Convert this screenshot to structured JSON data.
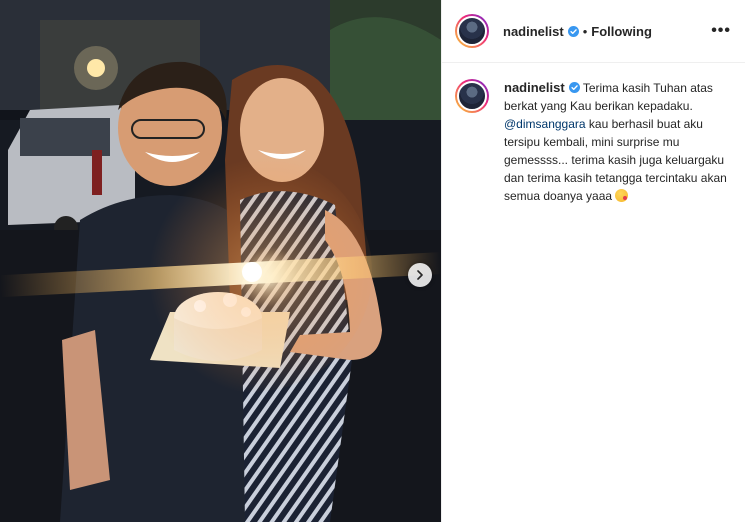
{
  "post": {
    "username": "nadinelist",
    "separator": "•",
    "follow_status": "Following",
    "more_label": "•••",
    "carousel_next_icon": "chevron-right-icon",
    "caption": {
      "text_1": "Terima kasih Tuhan atas berkat yang Kau berikan kepadaku. ",
      "mention": "@dimsanggara",
      "text_2": " kau berhasil buat aku tersipu kembali, mini surprise mu gemessss... terima kasih juga keluargaku dan terima kasih tetangga tercintaku akan semua doanya yaaa ",
      "emoji": "face-blowing-kiss"
    },
    "colors": {
      "verified": "#3897f0",
      "mention": "#00376b",
      "text": "#262626"
    }
  }
}
